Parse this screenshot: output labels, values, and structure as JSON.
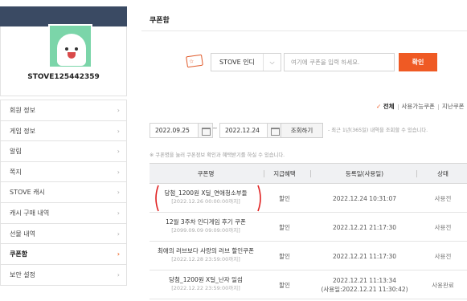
{
  "profile": {
    "username": "STOVE125442359"
  },
  "sidebar": {
    "items": [
      {
        "label": "회원 정보"
      },
      {
        "label": "게임 정보"
      },
      {
        "label": "알림"
      },
      {
        "label": "쪽지"
      },
      {
        "label": "STOVE 캐시"
      },
      {
        "label": "캐시 구매 내역"
      },
      {
        "label": "선물 내역"
      },
      {
        "label": "쿠폰함",
        "active": true
      },
      {
        "label": "보안 설정"
      }
    ],
    "chevron": "›"
  },
  "page": {
    "title": "쿠폰함"
  },
  "register": {
    "icon_text": "☆",
    "store_value": "STOVE 인디",
    "store_arrow": "⌵",
    "input_placeholder": "여기에 쿠폰을 입력 하세요.",
    "confirm_label": "확인"
  },
  "filters": {
    "check": "✓",
    "all": "전체",
    "usable": "사용가능쿠폰",
    "expired": "지난쿠폰"
  },
  "period": {
    "start": "2022.09.25",
    "tilde": "~",
    "end": "2022.12.24",
    "search_label": "조회하기",
    "note": "- 최근 1년(365일) 내역을 조회할 수 있습니다."
  },
  "notice": "※ 쿠폰명을 눌러 쿠폰정보 확인과 혜택받기를 하실 수 있습니다.",
  "table": {
    "headers": {
      "name": "쿠폰명",
      "benefit": "지급혜택",
      "date": "등록일(사용일)",
      "status": "상태"
    },
    "rows": [
      {
        "name": "당첨_1200원 X딜_연애청소부들",
        "period": "[2022.12.26 00:00:00까지]",
        "benefit": "할인",
        "date": "2022.12.24 10:31:07",
        "date2": "",
        "status": "사용전"
      },
      {
        "name": "12월 3주차 인디게임 후기 쿠폰",
        "period": "[2099.09.09 09:09:00까지]",
        "benefit": "할인",
        "date": "2022.12.21 21:17:30",
        "date2": "",
        "status": "사용전"
      },
      {
        "name": "최애의 러브보다 사랑의 러브 할인쿠폰",
        "period": "[2022.12.28 23:59:00까지]",
        "benefit": "할인",
        "date": "2022.12.21 11:17:30",
        "date2": "",
        "status": "사용전"
      },
      {
        "name": "당첨_1200원 X딜_난자 일섬",
        "period": "[2022.12.22 23:59:00까지]",
        "benefit": "할인",
        "date": "2022.12.21 11:13:34",
        "date2": "(사용일:2022.12.21 11:30:42)",
        "status": "사용완료"
      }
    ]
  },
  "colors": {
    "accent": "#ef5a24",
    "profile_band": "#3a4a63",
    "avatar_bg": "#7bd5a9",
    "annotation": "#e02020"
  }
}
